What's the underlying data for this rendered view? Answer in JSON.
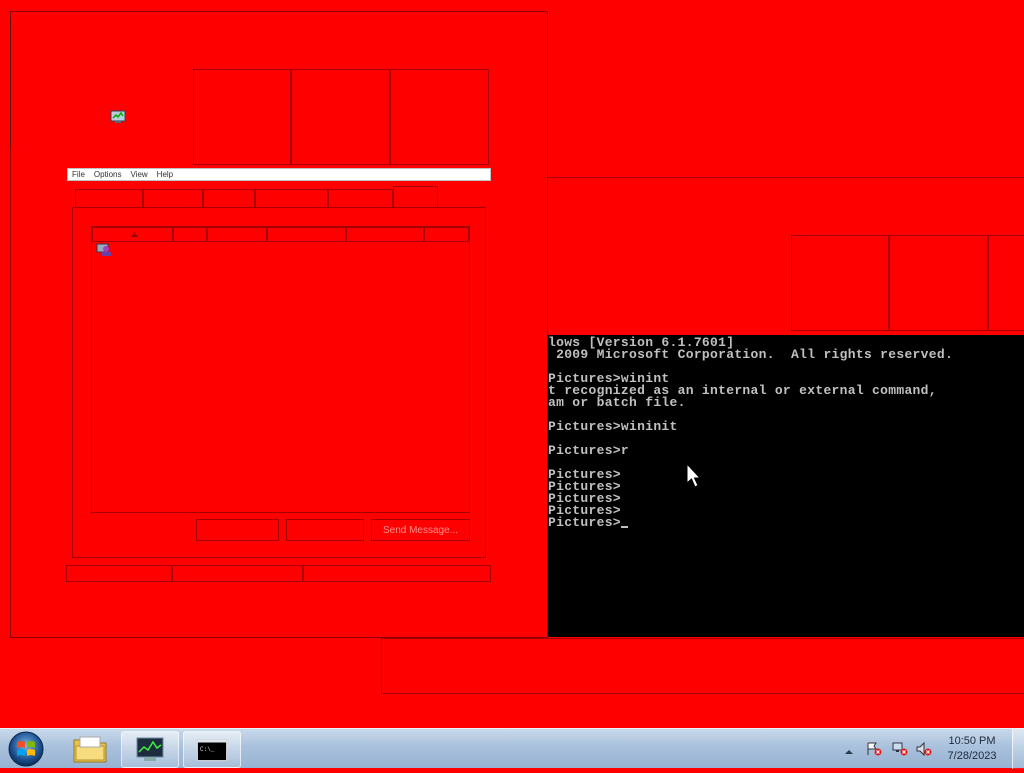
{
  "left_window": {
    "menu": [
      "File",
      "Options",
      "View",
      "Help"
    ],
    "send_message_label": "Send Message..."
  },
  "console": {
    "lines": [
      "lows [Version 6.1.7601]",
      " 2009 Microsoft Corporation.  All rights reserved.",
      "",
      "Pictures>winint",
      "t recognized as an internal or external command,",
      "am or batch file.",
      "",
      "Pictures>wininit",
      "",
      "Pictures>r",
      "",
      "Pictures>",
      "Pictures>",
      "Pictures>",
      "Pictures>",
      "Pictures>"
    ]
  },
  "taskbar": {
    "clock_time": "10:50 PM",
    "clock_date": "7/28/2023",
    "start_icon": "windows-orb-icon",
    "pinned": [
      "folder-icon",
      "task-manager-icon",
      "command-prompt-icon"
    ]
  }
}
